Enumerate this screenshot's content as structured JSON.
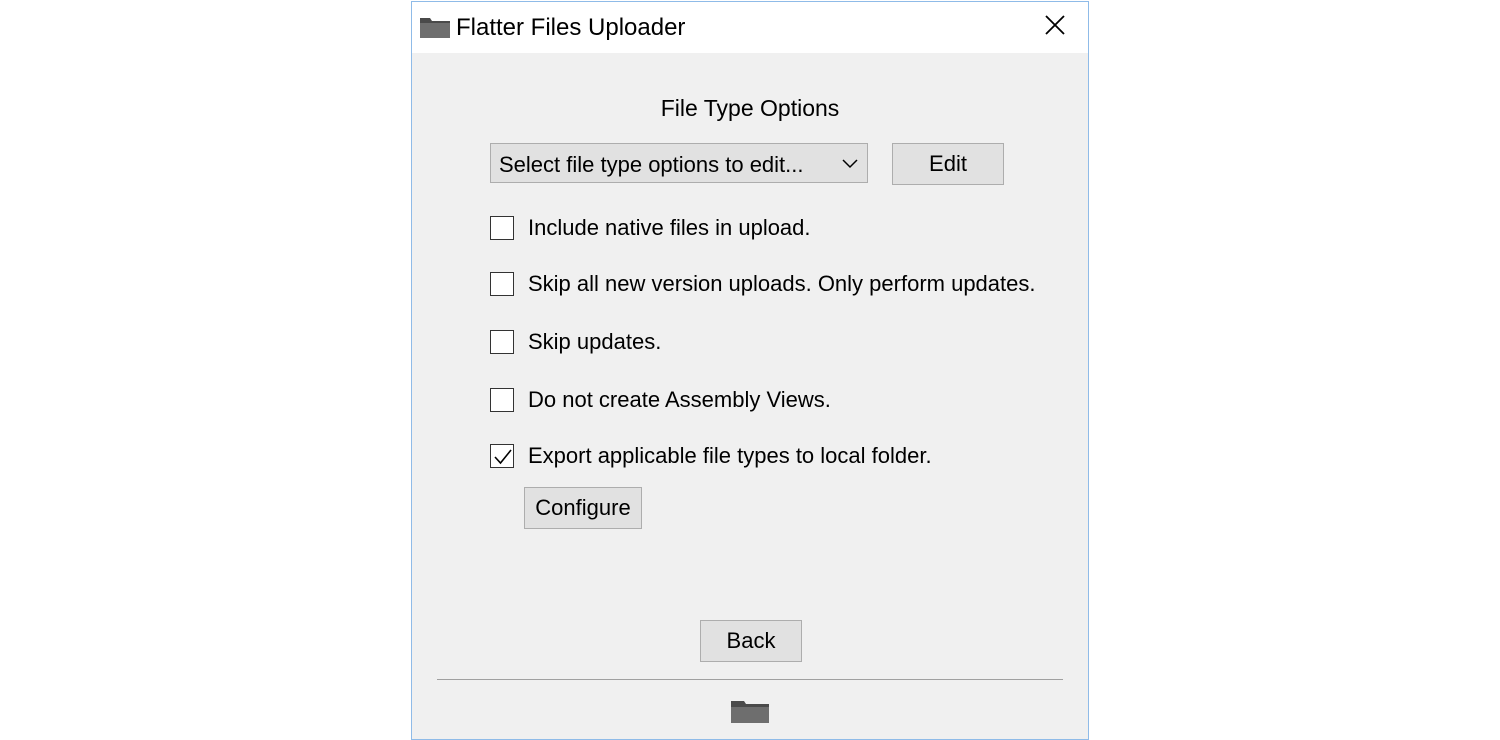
{
  "window": {
    "title": "Flatter Files Uploader",
    "app_icon": "folder-icon",
    "close_icon": "close-icon"
  },
  "main": {
    "section_title": "File Type Options",
    "dropdown": {
      "selected": "Select file type options to edit...",
      "icon": "chevron-down-icon"
    },
    "edit_label": "Edit",
    "options": [
      {
        "label": "Include native files in upload.",
        "checked": false
      },
      {
        "label": "Skip all new version uploads. Only perform updates.",
        "checked": false
      },
      {
        "label": "Skip updates.",
        "checked": false
      },
      {
        "label": "Do not create Assembly Views.",
        "checked": false
      },
      {
        "label": "Export applicable file types to local folder.",
        "checked": true
      }
    ],
    "configure_label": "Configure",
    "back_label": "Back"
  },
  "footer": {
    "icon": "folder-icon"
  }
}
